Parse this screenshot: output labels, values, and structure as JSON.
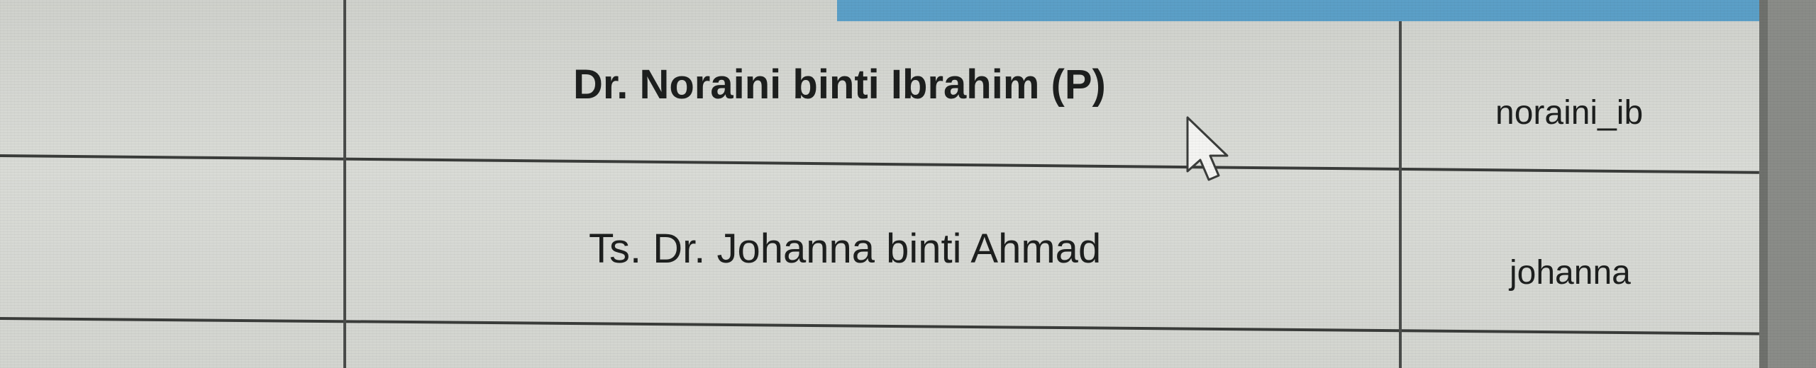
{
  "table": {
    "rows": [
      {
        "name": "Dr. Noraini binti Ibrahim (P)",
        "username": "noraini_ib"
      },
      {
        "name": "Ts. Dr. Johanna binti Ahmad",
        "username": "johanna"
      }
    ]
  },
  "colors": {
    "header_bar": "#5b9fc7",
    "cell_background": "#d4d6d2",
    "grid_line": "#3a3c3a",
    "text": "#1d1f1e"
  },
  "icons": {
    "cursor": "mouse-pointer-icon"
  }
}
